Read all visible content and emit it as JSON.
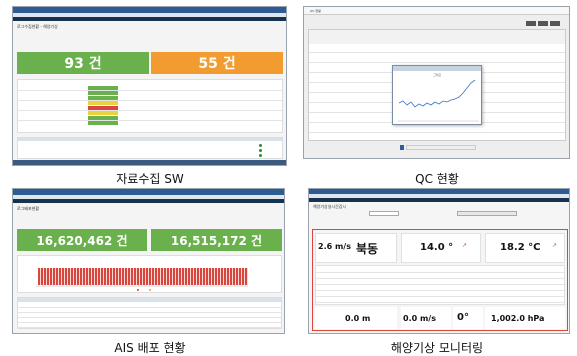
{
  "captions": {
    "p1": "자료수집 SW",
    "p2": "QC 현황",
    "p3": "AIS 배포 현황",
    "p4": "해양기상 모니터링"
  },
  "p1": {
    "page_title": "로그수집현황 - 해양기상",
    "card_left_value": "93 건",
    "card_right_value": "55 건"
  },
  "p2": {
    "section_title": "QC 현황",
    "popup_title": "그래프"
  },
  "p3": {
    "page_title": "로그배포현황",
    "card_left_value": "16,620,462 건",
    "card_right_value": "16,515,172 건"
  },
  "p4": {
    "page_title": "해양기상실시간감시",
    "wind_speed": "2.6 m/s",
    "wind_dir": "북동",
    "val_a": "14.0 °",
    "val_b": "18.2 °C",
    "wave": "0.0 m",
    "current": "0.0 m/s",
    "angle": "0°",
    "pressure": "1,002.0 hPa"
  },
  "colors": {
    "green": "#6ab04c",
    "orange": "#f29b30",
    "red": "#d9463d",
    "yellow": "#e9d23c"
  }
}
